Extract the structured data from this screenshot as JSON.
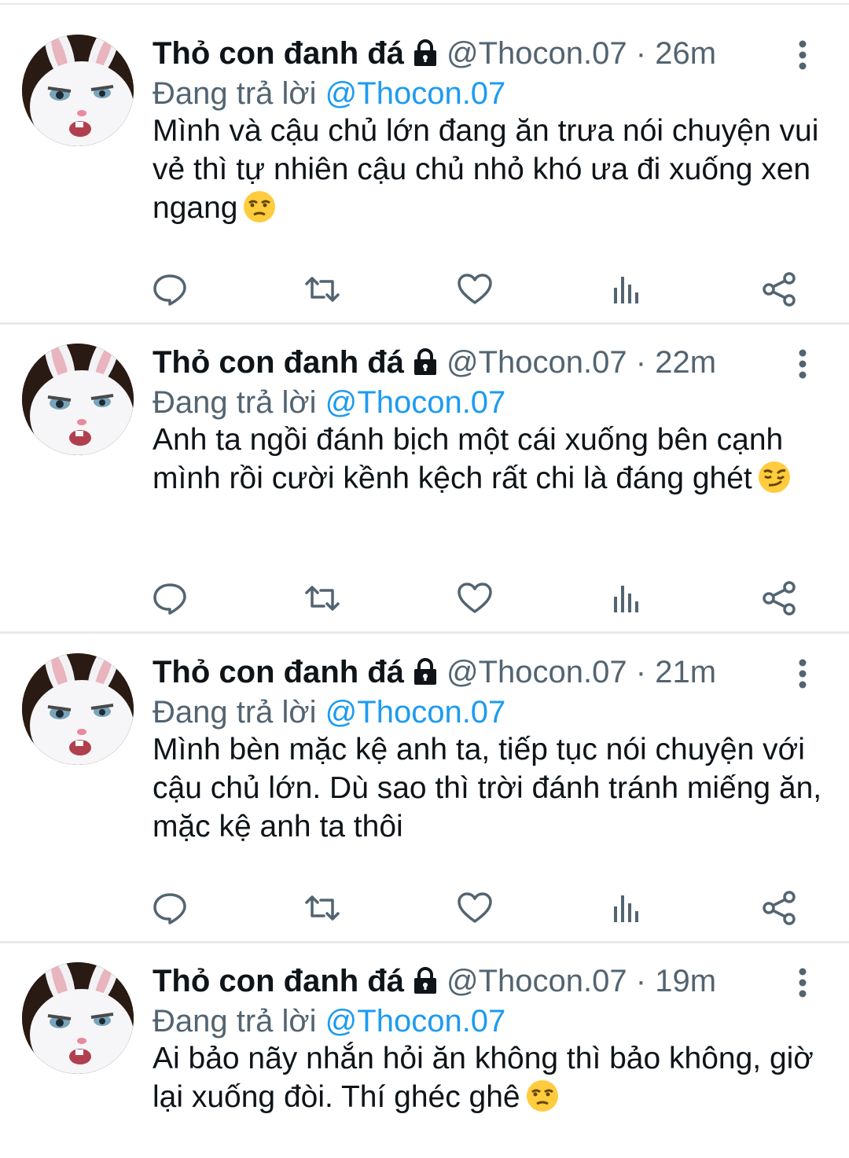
{
  "tweets": [
    {
      "name": "Thỏ con đanh đá",
      "handle": "@Thocon.07",
      "dot": "·",
      "time": "26m",
      "replying_prefix": "Đang trả lời",
      "replying_to": "@Thocon.07",
      "text": "Mình và cậu chủ lớn đang ăn trưa nói chuyện vui vẻ thì tự nhiên cậu chủ nhỏ khó ưa đi xuống xen ngang",
      "emoji": "unamused-face"
    },
    {
      "name": "Thỏ con đanh đá",
      "handle": "@Thocon.07",
      "dot": "·",
      "time": "22m",
      "replying_prefix": "Đang trả lời",
      "replying_to": "@Thocon.07",
      "text": "Anh ta ngồi đánh bịch một cái xuống bên cạnh mình rồi cười kềnh kệch rất chi là đáng ghét",
      "emoji": "smirking-face"
    },
    {
      "name": "Thỏ con đanh đá",
      "handle": "@Thocon.07",
      "dot": "·",
      "time": "21m",
      "replying_prefix": "Đang trả lời",
      "replying_to": "@Thocon.07",
      "text": "Mình bèn mặc kệ anh ta, tiếp tục nói chuyện với cậu chủ lớn. Dù sao thì trời đánh tránh miếng ăn, mặc kệ anh ta thôi",
      "emoji": ""
    },
    {
      "name": "Thỏ con đanh đá",
      "handle": "@Thocon.07",
      "dot": "·",
      "time": "19m",
      "replying_prefix": "Đang trả lời",
      "replying_to": "@Thocon.07",
      "text": "Ai bảo nãy nhắn hỏi ăn không thì bảo không, giờ lại xuống đòi. Thí ghéc ghê",
      "emoji": "unamused-face"
    }
  ],
  "icons": [
    "reply-icon",
    "retweet-icon",
    "like-icon",
    "analytics-icon",
    "share-icon",
    "lock-icon",
    "more-icon"
  ],
  "colors": {
    "name": "#0f1419",
    "secondary": "#536471",
    "mention": "#1d9bf0",
    "separator": "#e6e9ea"
  }
}
